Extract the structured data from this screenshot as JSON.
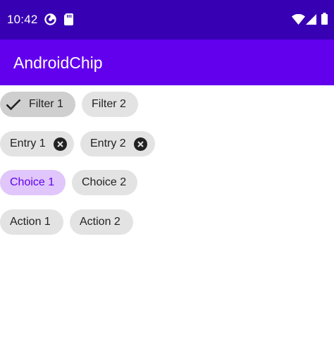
{
  "status_bar": {
    "time": "10:42",
    "left_icons": [
      "data-saver-icon",
      "sd-card-icon"
    ],
    "right_icons": [
      "wifi-icon",
      "cell-signal-icon",
      "battery-icon"
    ],
    "background": "#3700b3"
  },
  "app_bar": {
    "title": "AndroidChip",
    "background": "#6200ee"
  },
  "chips": {
    "filter": [
      {
        "label": "Filter 1",
        "selected": true,
        "icon": "check-icon"
      },
      {
        "label": "Filter 2",
        "selected": false
      }
    ],
    "entry": [
      {
        "label": "Entry 1",
        "close_icon": "cancel-icon"
      },
      {
        "label": "Entry 2",
        "close_icon": "cancel-icon"
      }
    ],
    "choice": [
      {
        "label": "Choice 1",
        "selected": true
      },
      {
        "label": "Choice 2",
        "selected": false
      }
    ],
    "action": [
      {
        "label": "Action 1"
      },
      {
        "label": "Action 2"
      }
    ]
  },
  "colors": {
    "chip_default": "#e3e3e3",
    "chip_filter_selected": "#cfcfcf",
    "chip_choice_selected": "#e0c6fa",
    "chip_choice_selected_text": "#6200ee"
  }
}
